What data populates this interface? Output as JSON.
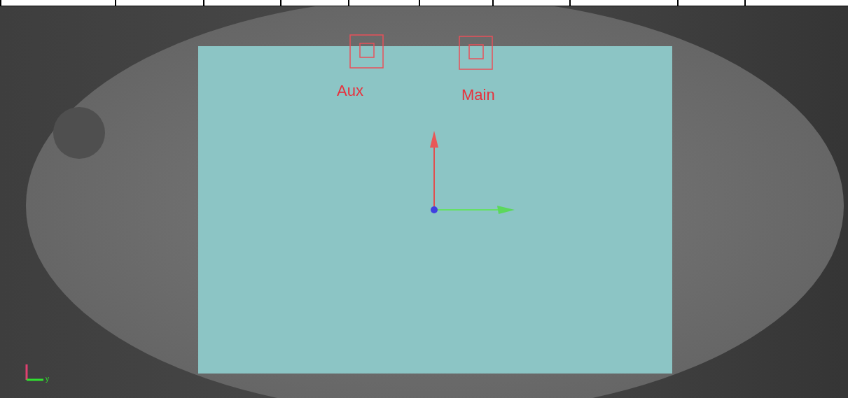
{
  "markers": [
    {
      "label": "Aux"
    },
    {
      "label": "Main"
    }
  ],
  "axis_indicator": {
    "y_label": "y"
  }
}
